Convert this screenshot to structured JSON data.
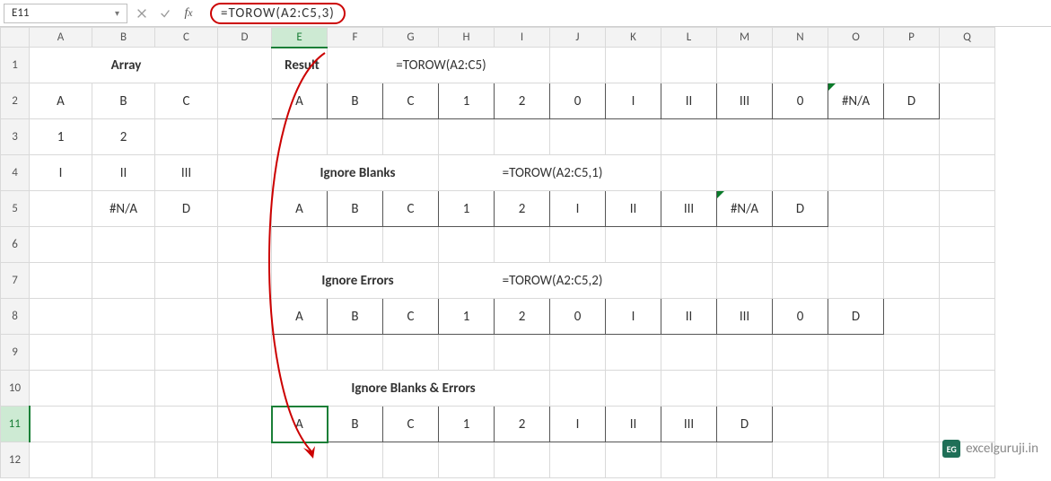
{
  "namebox": "E11",
  "formula": "=TOROW(A2:C5,3)",
  "cols": [
    "A",
    "B",
    "C",
    "D",
    "E",
    "F",
    "G",
    "H",
    "I",
    "J",
    "K",
    "L",
    "M",
    "N",
    "O",
    "P",
    "Q"
  ],
  "rows": [
    "1",
    "2",
    "3",
    "4",
    "5",
    "6",
    "7",
    "8",
    "9",
    "10",
    "11",
    "12"
  ],
  "labels": {
    "array": "Array",
    "result": "Result",
    "result_f": "=TOROW(A2:C5)",
    "ign_blanks": "Ignore Blanks",
    "ign_blanks_f": "=TOROW(A2:C5,1)",
    "ign_errors": "Ignore Errors",
    "ign_errors_f": "=TOROW(A2:C5,2)",
    "ign_both": "Ignore Blanks & Errors"
  },
  "array_data": [
    [
      "A",
      "B",
      "C"
    ],
    [
      "1",
      "2",
      ""
    ],
    [
      "I",
      "II",
      "III"
    ],
    [
      "",
      "#N/A",
      "D"
    ]
  ],
  "row_result": [
    "A",
    "B",
    "C",
    "1",
    "2",
    "0",
    "I",
    "II",
    "III",
    "0",
    "#N/A",
    "D"
  ],
  "row_ign_blanks": [
    "A",
    "B",
    "C",
    "1",
    "2",
    "I",
    "II",
    "III",
    "#N/A",
    "D"
  ],
  "row_ign_errors": [
    "A",
    "B",
    "C",
    "1",
    "2",
    "0",
    "I",
    "II",
    "III",
    "0",
    "D"
  ],
  "row_ign_both": [
    "A",
    "B",
    "C",
    "1",
    "2",
    "I",
    "II",
    "III",
    "D"
  ],
  "watermark": "excelguruji.in",
  "chart_data": {
    "type": "table",
    "title": "Excel TOROW function examples",
    "input_range": "A2:C5",
    "input_array": [
      [
        "A",
        "B",
        "C"
      ],
      [
        1,
        2,
        null
      ],
      [
        "I",
        "II",
        "III"
      ],
      [
        null,
        "#N/A",
        "D"
      ]
    ],
    "outputs": [
      {
        "label": "Result",
        "formula": "=TOROW(A2:C5)",
        "values": [
          "A",
          "B",
          "C",
          1,
          2,
          0,
          "I",
          "II",
          "III",
          0,
          "#N/A",
          "D"
        ]
      },
      {
        "label": "Ignore Blanks",
        "formula": "=TOROW(A2:C5,1)",
        "values": [
          "A",
          "B",
          "C",
          1,
          2,
          "I",
          "II",
          "III",
          "#N/A",
          "D"
        ]
      },
      {
        "label": "Ignore Errors",
        "formula": "=TOROW(A2:C5,2)",
        "values": [
          "A",
          "B",
          "C",
          1,
          2,
          0,
          "I",
          "II",
          "III",
          0,
          "D"
        ]
      },
      {
        "label": "Ignore Blanks & Errors",
        "formula": "=TOROW(A2:C5,3)",
        "values": [
          "A",
          "B",
          "C",
          1,
          2,
          "I",
          "II",
          "III",
          "D"
        ]
      }
    ]
  }
}
